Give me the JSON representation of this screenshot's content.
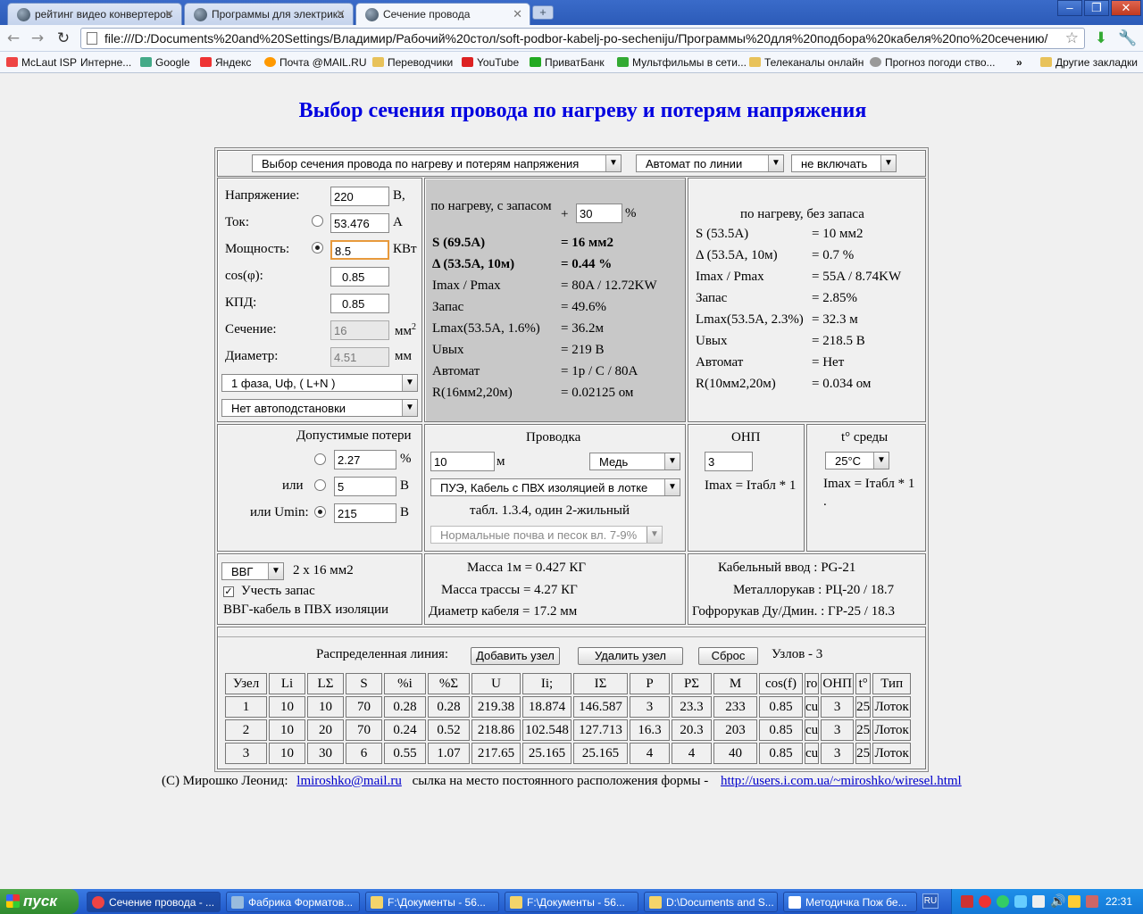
{
  "browser": {
    "tabs": [
      "рейтинг видео конвертеров",
      "Программы для электрика",
      "Сечение провода"
    ],
    "address": "file:///D:/Documents%20and%20Settings/Владимир/Рабочий%20стол/soft-podbor-kabelj-po-secheniju/Программы%20для%20подбора%20кабеля%20по%20сечению/",
    "bookmarks": [
      "McLaut ISP",
      "Интерне...",
      "Google",
      "Яндекс",
      "Почта @MAIL.RU",
      "Переводчики",
      "YouTube",
      "ПриватБанк",
      "Мультфильмы в сети...",
      "Телеканалы онлайн",
      "Прогноз погоди ство...",
      "»",
      "Другие закладки"
    ]
  },
  "title": "Выбор сечения провода по нагреву и потерям напряжения",
  "top_selects": {
    "mode": "Выбор сечения провода по нагреву и потерям напряжения",
    "breaker": "Автомат по линии",
    "include": "не включать"
  },
  "inputs": {
    "voltage_label": "Напряжение:",
    "voltage": "220",
    "voltage_unit": "В,",
    "current_label": "Ток:",
    "current": "53.476",
    "current_unit": "А",
    "power_label": "Мощность:",
    "power": "8.5",
    "power_unit": "КВт",
    "cos_label": "cos(φ):",
    "cos": "0.85",
    "kpd_label": "КПД:",
    "kpd": "0.85",
    "section_label": "Сечение:",
    "section": "16",
    "section_unit": "мм",
    "diameter_label": "Диаметр:",
    "diameter": "4.51",
    "diameter_unit": "мм",
    "phase": "1 фаза, Uф,  ( L+N )",
    "auto_sub": "Нет автоподстановки"
  },
  "with_reserve": {
    "header": "по нагреву, с запасом",
    "plus": "+",
    "percent": "30",
    "percent_unit": "%",
    "rows": [
      {
        "k": "S (69.5A)",
        "v": "= 16 мм2",
        "bold": true
      },
      {
        "k": "Δ (53.5A, 10м)",
        "v": "= 0.44 %",
        "bold": true
      },
      {
        "k": "Imax / Pmax",
        "v": "= 80A / 12.72KW"
      },
      {
        "k": "Запас",
        "v": "= 49.6%"
      },
      {
        "k": "Lmax(53.5A, 1.6%)",
        "v": "= 36.2м"
      },
      {
        "k": "Uвых",
        "v": "= 219 В"
      },
      {
        "k": "Автомат",
        "v": "= 1p / C / 80A"
      },
      {
        "k": "R(16мм2,20м)",
        "v": "= 0.02125 ом"
      }
    ]
  },
  "no_reserve": {
    "header": "по нагреву, без запаса",
    "rows": [
      {
        "k": "S (53.5A)",
        "v": "= 10 мм2"
      },
      {
        "k": "Δ (53.5A, 10м)",
        "v": "= 0.7 %"
      },
      {
        "k": "Imax / Pmax",
        "v": "= 55A / 8.74KW"
      },
      {
        "k": "Запас",
        "v": "= 2.85%"
      },
      {
        "k": "Lmax(53.5A, 2.3%)",
        "v": "= 32.3 м"
      },
      {
        "k": "Uвых",
        "v": "= 218.5 В"
      },
      {
        "k": "Автомат",
        "v": "= Нет"
      },
      {
        "k": "R(10мм2,20м)",
        "v": "= 0.034 ом"
      }
    ]
  },
  "losses": {
    "title": "Допустимые потери",
    "pct": "2.27",
    "pct_unit": "%",
    "or1": "или",
    "volt": "5",
    "volt_unit": "В",
    "or2": "или Umin:",
    "umin": "215",
    "umin_unit": "В"
  },
  "wiring": {
    "title": "Проводка",
    "length": "10",
    "length_unit": "м",
    "material": "Медь",
    "method": "ПУЭ, Кабель с ПВХ изоляцией в лотке",
    "table_ref": "табл. 1.3.4, один 2-жильный",
    "soil": "Нормальные почва и песок вл. 7-9%"
  },
  "onp": {
    "title": "ОНП",
    "value": "3",
    "formula": "Imax = Iтабл * 1"
  },
  "temp": {
    "title": "t° среды",
    "value": "25°C",
    "formula": "Imax = Iтабл * 1",
    "dot": "."
  },
  "cable": {
    "type": "ВВГ",
    "spec": "2 x 16 мм2",
    "reserve_label": "Учесть запас",
    "desc": "ВВГ-кабель в ПВХ изоляции"
  },
  "mass": {
    "m1": "Масса 1м = 0.427  КГ",
    "m2": "Масса трассы = 4.27  КГ",
    "m3": "Диаметр кабеля = 17.2  мм"
  },
  "entries": {
    "e1": "Кабельный ввод : PG-21",
    "e2": "Металлорукав : РЦ-20 / 18.7",
    "e3": "Гофрорукав Ду/Дмин. : ГР-25 / 18.3"
  },
  "distributed": {
    "label": "Распределенная линия:",
    "add": "Добавить узел",
    "remove": "Удалить узел",
    "reset": "Сброс",
    "nodes": "Узлов - 3"
  },
  "table": {
    "headers": [
      "Узел",
      "Li",
      "LΣ",
      "S",
      "%i",
      "%Σ",
      "U",
      "Ii;",
      "IΣ",
      "P",
      "PΣ",
      "M",
      "cos(f)",
      "ro",
      "ОНП",
      "t°",
      "Тип"
    ],
    "rows": [
      [
        "1",
        "10",
        "10",
        "70",
        "0.28",
        "0.28",
        "219.38",
        "18.874",
        "146.587",
        "3",
        "23.3",
        "233",
        "0.85",
        "cu",
        "3",
        "25",
        "Лоток"
      ],
      [
        "2",
        "10",
        "20",
        "70",
        "0.24",
        "0.52",
        "218.86",
        "102.548",
        "127.713",
        "16.3",
        "20.3",
        "203",
        "0.85",
        "cu",
        "3",
        "25",
        "Лоток"
      ],
      [
        "3",
        "10",
        "30",
        "6",
        "0.55",
        "1.07",
        "217.65",
        "25.165",
        "25.165",
        "4",
        "4",
        "40",
        "0.85",
        "cu",
        "3",
        "25",
        "Лоток"
      ]
    ]
  },
  "footer": {
    "author": "(C) Мирошко Леонид:",
    "email": "lmiroshko@mail.ru",
    "note": "сылка на место постоянного расположения формы -",
    "url": "http://users.i.com.ua/~miroshko/wiresel.html"
  },
  "taskbar": {
    "start": "пуск",
    "items": [
      "Сечение провода - ...",
      "Фабрика Форматов...",
      "F:\\Документы - 56...",
      "F:\\Документы - 56...",
      "D:\\Documents and S...",
      "Методичка Пож бе..."
    ],
    "lang": "RU",
    "time": "22:31"
  }
}
